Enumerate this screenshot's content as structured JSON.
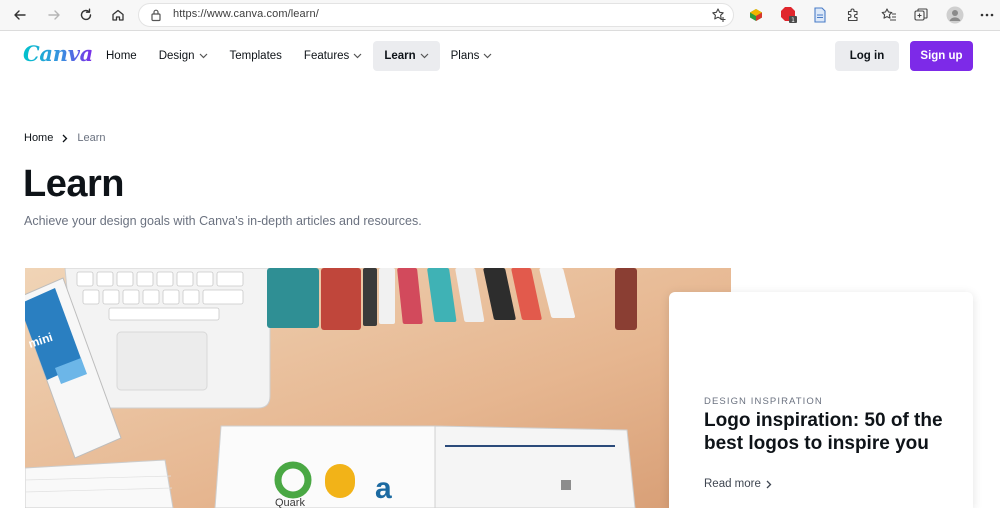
{
  "browser": {
    "url": "https://www.canva.com/learn/",
    "back_icon": "arrow-left-icon",
    "forward_icon": "arrow-right-icon",
    "reload_icon": "reload-icon",
    "home_icon": "home-icon",
    "extensions": [
      {
        "name": "extension-multicolor-icon"
      },
      {
        "name": "adblock-extension-icon",
        "badge": "1"
      },
      {
        "name": "document-extension-icon"
      },
      {
        "name": "puzzle-extensions-icon"
      },
      {
        "name": "favorites-icon"
      },
      {
        "name": "collections-icon"
      },
      {
        "name": "profile-avatar"
      },
      {
        "name": "more-menu-icon"
      }
    ]
  },
  "header": {
    "logo": "Canva",
    "nav": [
      {
        "label": "Home",
        "dropdown": false
      },
      {
        "label": "Design",
        "dropdown": true
      },
      {
        "label": "Templates",
        "dropdown": false
      },
      {
        "label": "Features",
        "dropdown": true
      },
      {
        "label": "Learn",
        "dropdown": true,
        "active": true
      },
      {
        "label": "Plans",
        "dropdown": true
      }
    ],
    "login_label": "Log in",
    "signup_label": "Sign up"
  },
  "breadcrumb": {
    "home": "Home",
    "current": "Learn"
  },
  "page": {
    "title": "Learn",
    "subtitle": "Achieve your design goals with Canva's in-depth articles and resources."
  },
  "feature": {
    "category": "DESIGN INSPIRATION",
    "title": "Logo inspiration: 50 of the best logos to inspire you",
    "cta": "Read more",
    "image_text": {
      "book_text": "mini",
      "logo_caption": "Quark"
    }
  },
  "colors": {
    "brand_purple": "#7d2ae8",
    "brand_teal": "#01c3cc",
    "text_dark": "#0e1318",
    "text_muted": "#6b7280",
    "button_grey": "#ebecef"
  }
}
